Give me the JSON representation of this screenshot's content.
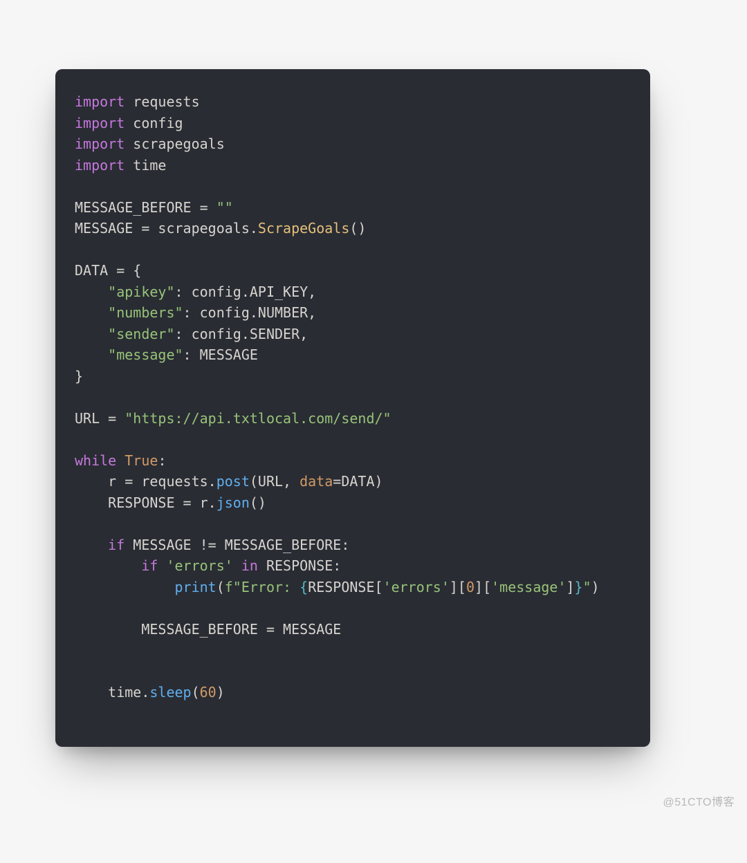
{
  "watermark": "@51CTO博客",
  "code": {
    "imports": [
      "requests",
      "config",
      "scrapegoals",
      "time"
    ],
    "keyword_import": "import",
    "msg_before_decl": "MESSAGE_BEFORE = ",
    "msg_before_val": "\"\"",
    "msg_decl": "MESSAGE = scrapegoals.",
    "scrape_cls": "ScrapeGoals",
    "msg_decl_tail": "()",
    "data_head": "DATA = {",
    "data_k1": "\"apikey\"",
    "data_v1": ": config.API_KEY,",
    "data_k2": "\"numbers\"",
    "data_v2": ": config.NUMBER,",
    "data_k3": "\"sender\"",
    "data_v3": ": config.SENDER,",
    "data_k4": "\"message\"",
    "data_v4": ": MESSAGE",
    "data_tail": "}",
    "url_decl": "URL = ",
    "url_val": "\"https://api.txtlocal.com/send/\"",
    "while_kw": "while",
    "true_kw": "True",
    "colon": ":",
    "r_decl": "    r = requests.",
    "post_fn": "post",
    "r_args_open": "(URL, ",
    "data_arg": "data",
    "r_args_close": "=DATA)",
    "resp_decl": "    RESPONSE = r.",
    "json_fn": "json",
    "resp_tail": "()",
    "if_kw": "if",
    "cond1": " MESSAGE != MESSAGE_BEFORE:",
    "cond2a": " ",
    "errors_str": "'errors'",
    "in_kw": " in ",
    "cond2b": "RESPONSE:",
    "print_pad": "            ",
    "print_fn": "print",
    "print_open": "(",
    "f_prefix": "f\"Error: ",
    "interp_open": "{",
    "interp_body": "RESPONSE[",
    "err_k1": "'errors'",
    "interp_mid": "][",
    "zero": "0",
    "interp_mid2": "][",
    "err_k2": "'message'",
    "interp_end": "]",
    "interp_close": "}",
    "f_suffix": "\"",
    "print_close": ")",
    "assign_back": "        MESSAGE_BEFORE = MESSAGE",
    "sleep_pad": "    time.",
    "sleep_fn": "sleep",
    "sleep_open": "(",
    "sixty": "60",
    "sleep_close": ")"
  }
}
